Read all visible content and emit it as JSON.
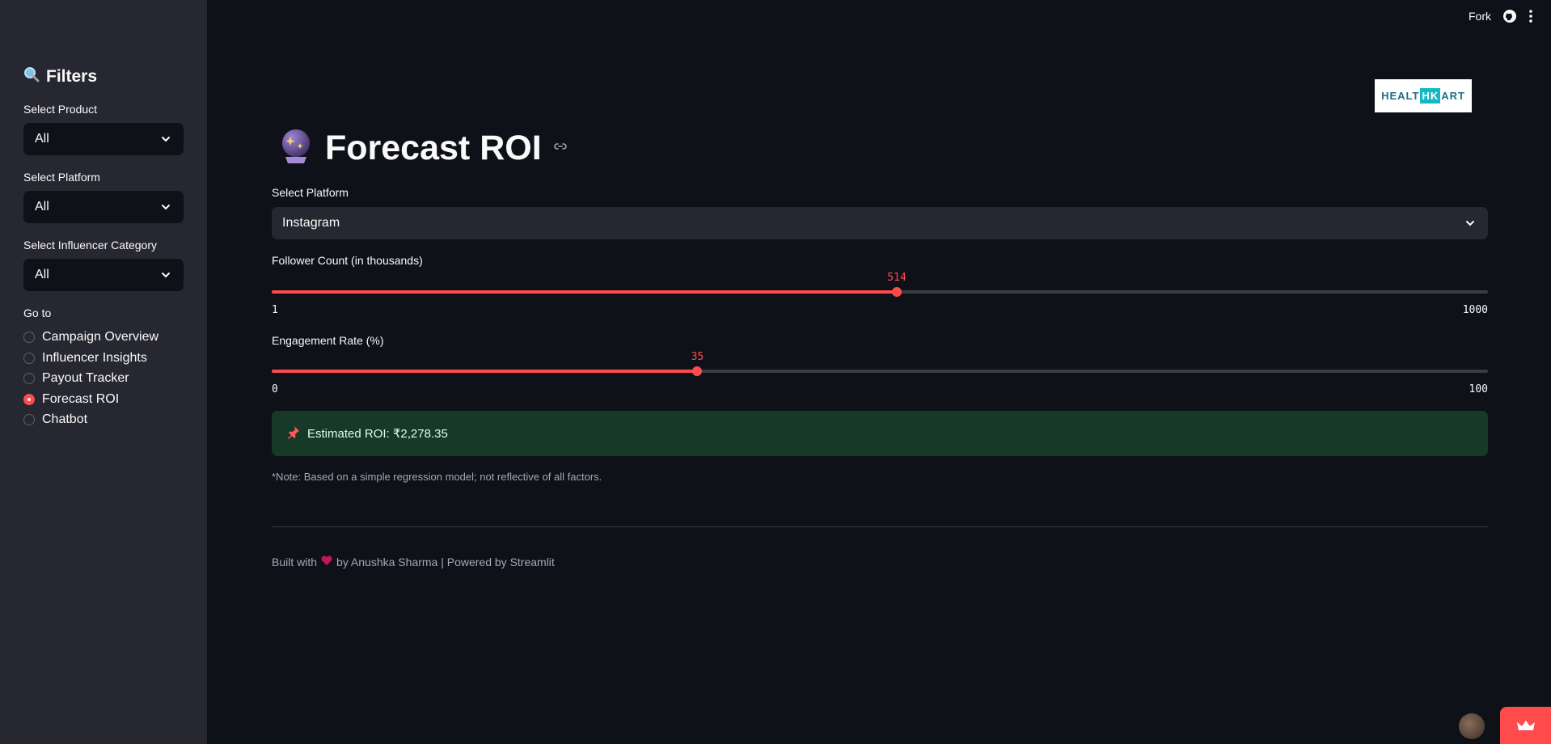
{
  "header": {
    "fork_label": "Fork"
  },
  "sidebar": {
    "title": "Filters",
    "filters": [
      {
        "label": "Select Product",
        "value": "All"
      },
      {
        "label": "Select Platform",
        "value": "All"
      },
      {
        "label": "Select Influencer Category",
        "value": "All"
      }
    ],
    "goto_label": "Go to",
    "nav": [
      {
        "label": "Campaign Overview",
        "selected": false
      },
      {
        "label": "Influencer Insights",
        "selected": false
      },
      {
        "label": "Payout Tracker",
        "selected": false
      },
      {
        "label": "Forecast ROI",
        "selected": true
      },
      {
        "label": "Chatbot",
        "selected": false
      }
    ]
  },
  "logo": {
    "left": "HEALT",
    "mid": "HK",
    "right": "ART"
  },
  "main": {
    "title": "Forecast ROI",
    "platform_label": "Select Platform",
    "platform_value": "Instagram",
    "follower": {
      "label": "Follower Count (in thousands)",
      "value": "514",
      "min": "1",
      "max": "1000",
      "fraction": 0.514
    },
    "engagement": {
      "label": "Engagement Rate (%)",
      "value": "35",
      "min": "0",
      "max": "100",
      "fraction": 0.35
    },
    "result": "Estimated ROI: ₹2,278.35",
    "note": "*Note: Based on a simple regression model; not reflective of all factors.",
    "footer_prefix": "Built with",
    "footer_suffix": "by Anushka Sharma | Powered by Streamlit"
  },
  "colors": {
    "accent": "#ff4b4b",
    "background": "#0e1117",
    "sidebar": "#262730",
    "success_bg": "#173928"
  }
}
